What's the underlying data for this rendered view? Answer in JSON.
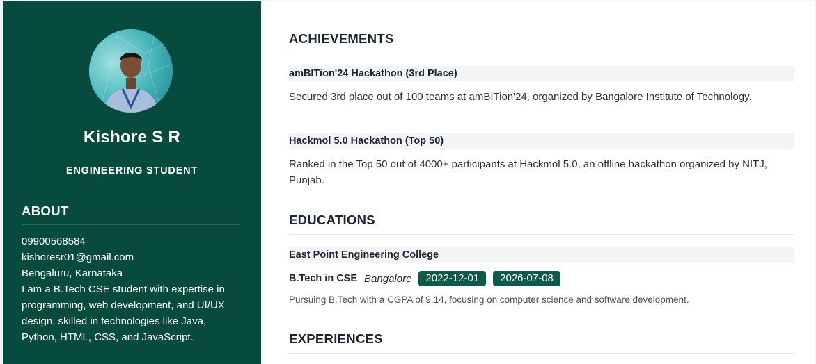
{
  "sidebar": {
    "name": "Kishore S R",
    "role": "ENGINEERING STUDENT",
    "about_heading": "ABOUT",
    "phone": "09900568584",
    "email": "kishoresr01@gmail.com",
    "location": "Bengaluru, Karnataka",
    "bio": "I am a B.Tech CSE student with expertise in programming, web development, and UI/UX design, skilled in technologies like Java, Python, HTML, CSS, and JavaScript.",
    "colors": {
      "background": "#074b3f",
      "text": "#ffffff"
    }
  },
  "achievements": {
    "heading": "ACHIEVEMENTS",
    "items": [
      {
        "title": "amBITion'24 Hackathon (3rd Place)",
        "description": "Secured 3rd place out of 100 teams at amBITion'24, organized by Bangalore Institute of Technology."
      },
      {
        "title": "Hackmol 5.0 Hackathon (Top 50)",
        "description": "Ranked in the Top 50 out of 4000+ participants at Hackmol 5.0, an offline hackathon organized by NITJ, Punjab."
      }
    ]
  },
  "educations": {
    "heading": "EDUCATIONS",
    "items": [
      {
        "institution": "East Point Engineering College",
        "degree": "B.Tech in CSE",
        "location": "Bangalore",
        "start_date": "2022-12-01",
        "end_date": "2026-07-08",
        "description": "Pursuing B.Tech with a CGPA of 9.14, focusing on computer science and software development."
      }
    ]
  },
  "experiences": {
    "heading": "EXPERIENCES"
  },
  "colors": {
    "accent": "#0d5a4a",
    "heading": "#1e2532"
  }
}
